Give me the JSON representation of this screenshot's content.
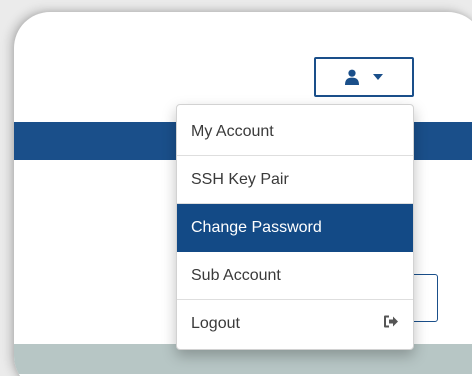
{
  "user_menu": {
    "toggle_icon": "user-icon",
    "caret_icon": "caret-down-icon",
    "items": [
      {
        "label": "My Account",
        "active": false
      },
      {
        "label": "SSH Key Pair",
        "active": false
      },
      {
        "label": "Change Password",
        "active": true
      },
      {
        "label": "Sub Account",
        "active": false
      },
      {
        "label": "Logout",
        "active": false,
        "icon": "sign-out-icon"
      }
    ]
  },
  "colors": {
    "primary": "#1a4f8a",
    "active_item": "#134a86",
    "footer": "#b7c6c5"
  }
}
